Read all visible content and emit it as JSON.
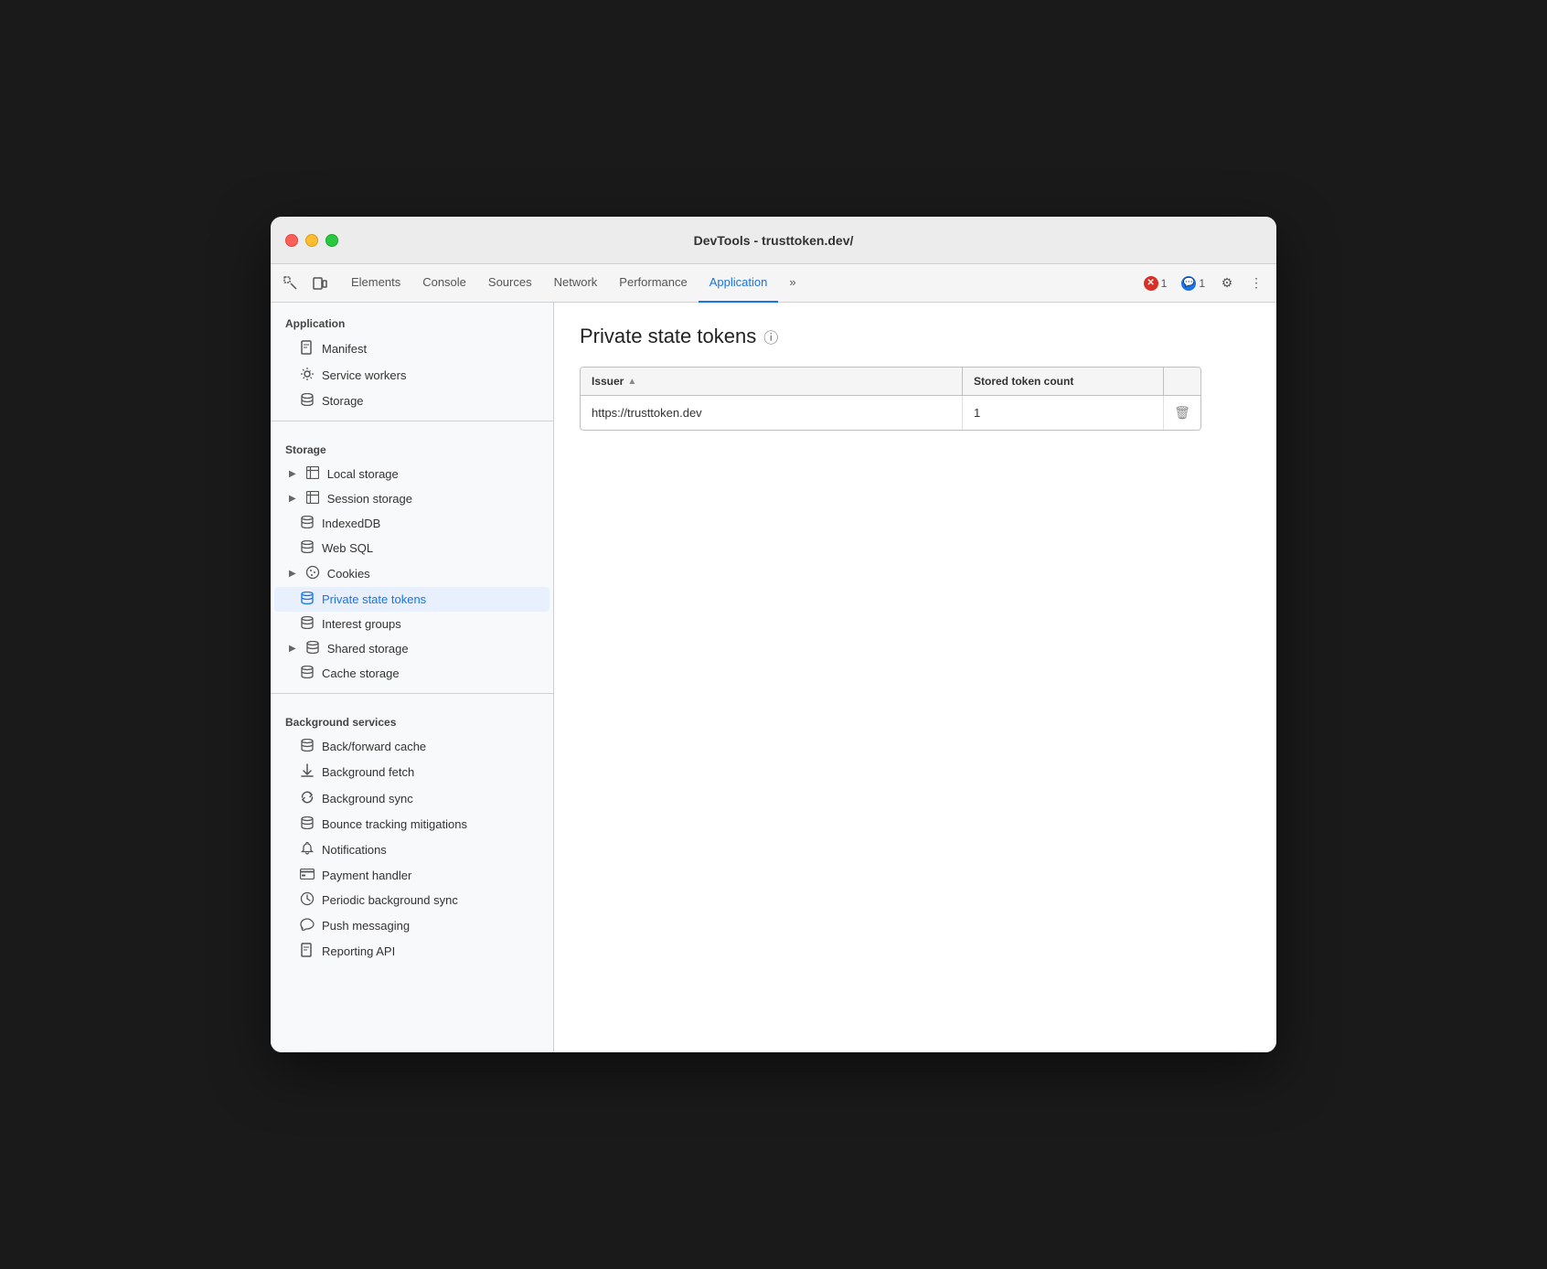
{
  "window": {
    "title": "DevTools - trusttoken.dev/"
  },
  "tabs": [
    {
      "id": "elements",
      "label": "Elements",
      "active": false
    },
    {
      "id": "console",
      "label": "Console",
      "active": false
    },
    {
      "id": "sources",
      "label": "Sources",
      "active": false
    },
    {
      "id": "network",
      "label": "Network",
      "active": false
    },
    {
      "id": "performance",
      "label": "Performance",
      "active": false
    },
    {
      "id": "application",
      "label": "Application",
      "active": true
    },
    {
      "id": "more",
      "label": "»",
      "active": false
    }
  ],
  "toolbar": {
    "error_count": "1",
    "info_count": "1"
  },
  "sidebar": {
    "application_section": "Application",
    "application_items": [
      {
        "id": "manifest",
        "label": "Manifest",
        "icon": "📄"
      },
      {
        "id": "service-workers",
        "label": "Service workers",
        "icon": "⚙"
      },
      {
        "id": "storage",
        "label": "Storage",
        "icon": "🗄"
      }
    ],
    "storage_section": "Storage",
    "storage_items": [
      {
        "id": "local-storage",
        "label": "Local storage",
        "icon": "⊞",
        "has_arrow": true,
        "arrow_open": false
      },
      {
        "id": "session-storage",
        "label": "Session storage",
        "icon": "⊞",
        "has_arrow": true,
        "arrow_open": false
      },
      {
        "id": "indexeddb",
        "label": "IndexedDB",
        "icon": "🗄",
        "has_arrow": false
      },
      {
        "id": "web-sql",
        "label": "Web SQL",
        "icon": "🗄",
        "has_arrow": false
      },
      {
        "id": "cookies",
        "label": "Cookies",
        "icon": "🍪",
        "has_arrow": true,
        "arrow_open": false
      },
      {
        "id": "private-state-tokens",
        "label": "Private state tokens",
        "icon": "🗄",
        "has_arrow": false,
        "active": true
      },
      {
        "id": "interest-groups",
        "label": "Interest groups",
        "icon": "🗄",
        "has_arrow": false
      },
      {
        "id": "shared-storage",
        "label": "Shared storage",
        "icon": "🗄",
        "has_arrow": true,
        "arrow_open": false
      },
      {
        "id": "cache-storage",
        "label": "Cache storage",
        "icon": "🗄",
        "has_arrow": false
      }
    ],
    "background_section": "Background services",
    "background_items": [
      {
        "id": "back-forward-cache",
        "label": "Back/forward cache",
        "icon": "🗄"
      },
      {
        "id": "background-fetch",
        "label": "Background fetch",
        "icon": "↕"
      },
      {
        "id": "background-sync",
        "label": "Background sync",
        "icon": "↻"
      },
      {
        "id": "bounce-tracking",
        "label": "Bounce tracking mitigations",
        "icon": "🗄"
      },
      {
        "id": "notifications",
        "label": "Notifications",
        "icon": "🔔"
      },
      {
        "id": "payment-handler",
        "label": "Payment handler",
        "icon": "💳"
      },
      {
        "id": "periodic-background-sync",
        "label": "Periodic background sync",
        "icon": "🕐"
      },
      {
        "id": "push-messaging",
        "label": "Push messaging",
        "icon": "☁"
      },
      {
        "id": "reporting-api",
        "label": "Reporting API",
        "icon": "📄"
      }
    ]
  },
  "content": {
    "page_title": "Private state tokens",
    "table": {
      "columns": [
        {
          "id": "issuer",
          "label": "Issuer",
          "sortable": true
        },
        {
          "id": "token-count",
          "label": "Stored token count",
          "sortable": false
        },
        {
          "id": "actions",
          "label": "",
          "sortable": false
        }
      ],
      "rows": [
        {
          "issuer": "https://trusttoken.dev",
          "token_count": "1"
        }
      ]
    }
  }
}
